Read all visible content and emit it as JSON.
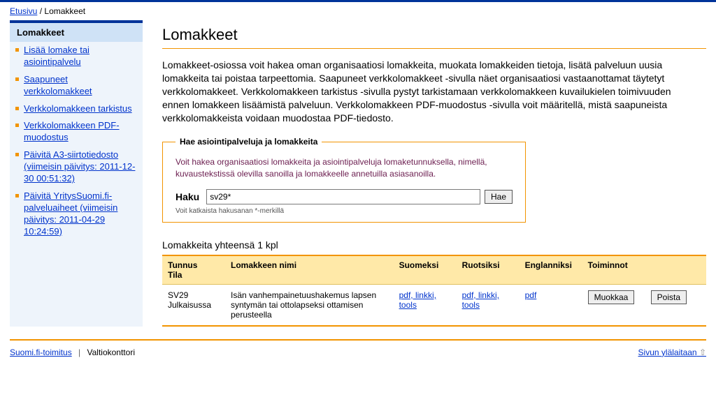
{
  "breadcrumb": {
    "home": "Etusivu",
    "sep": "/",
    "current": "Lomakkeet"
  },
  "sidebar": {
    "heading": "Lomakkeet",
    "items": [
      {
        "label": "Lisää lomake tai asiointipalvelu"
      },
      {
        "label": "Saapuneet verkkolomakkeet"
      },
      {
        "label": "Verkkolomakkeen tarkistus"
      },
      {
        "label": "Verkkolomakkeen PDF-muodostus"
      },
      {
        "label": "Päivitä A3-siirtotiedosto (viimeisin päivitys: 2011-12-30 00:51:32)"
      },
      {
        "label": "Päivitä YritysSuomi.fi-palveluaiheet (viimeisin päivitys: 2011-04-29 10:24:59)"
      }
    ]
  },
  "main": {
    "title": "Lomakkeet",
    "intro": "Lomakkeet-osiossa voit hakea oman organisaatiosi lomakkeita, muokata lomakkeiden tietoja, lisätä palveluun uusia lomakkeita tai poistaa tarpeettomia. Saapuneet verkkolomakkeet -sivulla näet organisaatiosi vastaanottamat täytetyt verkkolomakkeet. Verkkolomakkeen tarkistus -sivulla pystyt tarkistamaan verkkolomakkeen kuvailukielen toimivuuden ennen lomakkeen lisäämistä palveluun. Verkkolomakkeen PDF-muodostus -sivulla voit määritellä, mistä saapuneista verkkolomakkeista voidaan muodostaa PDF-tiedosto.",
    "search": {
      "legend": "Hae asiointipalveluja ja lomakkeita",
      "desc": "Voit hakea organisaatiosi lomakkeita ja asiointipalveluja lomaketunnuksella, nimellä, kuvaustekstissä olevilla sanoilla ja lomakkeelle annetuilla asiasanoilla.",
      "label": "Haku",
      "value": "sv29*",
      "button": "Hae",
      "hint": "Voit katkaista hakusanan *-merkillä"
    },
    "results_count": "Lomakkeita yhteensä 1 kpl",
    "table": {
      "headers": {
        "id_status_l1": "Tunnus",
        "id_status_l2": "Tila",
        "name": "Lomakkeen nimi",
        "fi": "Suomeksi",
        "sv": "Ruotsiksi",
        "en": "Englanniksi",
        "actions": "Toiminnot"
      },
      "rows": [
        {
          "id": "SV29",
          "status": "Julkaisussa",
          "name": "Isän vanhempainetuushakemus lapsen syntymän tai ottolapseksi ottamisen perusteella",
          "fi": "pdf, linkki, tools",
          "sv": "pdf, linkki, tools",
          "en": "pdf",
          "edit": "Muokkaa",
          "delete": "Poista"
        }
      ]
    }
  },
  "footer": {
    "link": "Suomi.fi-toimitus",
    "sep": "|",
    "org": "Valtiokonttori",
    "top": "Sivun ylälaitaan"
  }
}
